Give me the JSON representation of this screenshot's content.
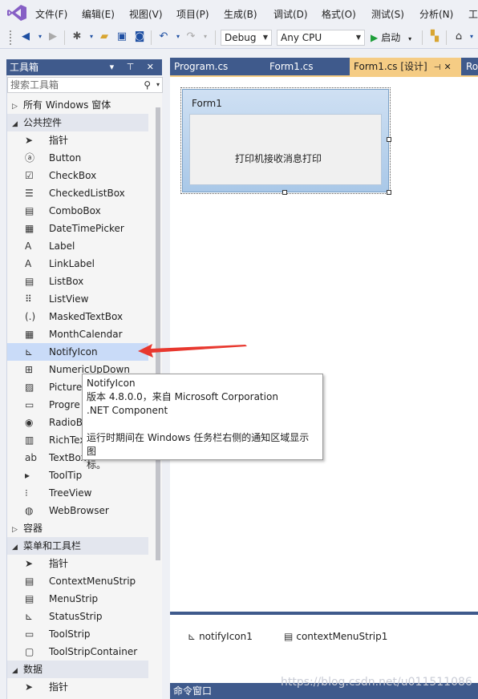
{
  "menubar": {
    "items": [
      "文件(F)",
      "编辑(E)",
      "视图(V)",
      "项目(P)",
      "生成(B)",
      "调试(D)",
      "格式(O)",
      "测试(S)",
      "分析(N)",
      "工"
    ]
  },
  "toolbar": {
    "config": "Debug",
    "platform": "Any CPU",
    "start_label": "启动"
  },
  "toolbox": {
    "title": "工具箱",
    "header_controls": "▾ ⊤ ✕",
    "search_placeholder": "搜索工具箱",
    "rows": [
      {
        "kind": "cat",
        "open": false,
        "label": "所有 Windows 窗体"
      },
      {
        "kind": "cat",
        "open": true,
        "label": "公共控件"
      },
      {
        "kind": "item",
        "icon": "pointer-icon",
        "label": "指针"
      },
      {
        "kind": "item",
        "icon": "button-icon",
        "label": "Button"
      },
      {
        "kind": "item",
        "icon": "checkbox-icon",
        "label": "CheckBox"
      },
      {
        "kind": "item",
        "icon": "checkedlistbox-icon",
        "label": "CheckedListBox"
      },
      {
        "kind": "item",
        "icon": "combobox-icon",
        "label": "ComboBox"
      },
      {
        "kind": "item",
        "icon": "datetimepicker-icon",
        "label": "DateTimePicker"
      },
      {
        "kind": "item",
        "icon": "label-icon",
        "label": "Label"
      },
      {
        "kind": "item",
        "icon": "linklabel-icon",
        "label": "LinkLabel"
      },
      {
        "kind": "item",
        "icon": "listbox-icon",
        "label": "ListBox"
      },
      {
        "kind": "item",
        "icon": "listview-icon",
        "label": "ListView"
      },
      {
        "kind": "item",
        "icon": "maskedtextbox-icon",
        "label": "MaskedTextBox"
      },
      {
        "kind": "item",
        "icon": "monthcalendar-icon",
        "label": "MonthCalendar"
      },
      {
        "kind": "item",
        "icon": "notifyicon-icon",
        "label": "NotifyIcon",
        "selected": true
      },
      {
        "kind": "item",
        "icon": "numericupdown-icon",
        "label": "NumericUpDown"
      },
      {
        "kind": "item",
        "icon": "picturebox-icon",
        "label": "Picture"
      },
      {
        "kind": "item",
        "icon": "progressbar-icon",
        "label": "Progre"
      },
      {
        "kind": "item",
        "icon": "radiobutton-icon",
        "label": "RadioB"
      },
      {
        "kind": "item",
        "icon": "richtextbox-icon",
        "label": "RichTex"
      },
      {
        "kind": "item",
        "icon": "textbox-icon",
        "label": "TextBox"
      },
      {
        "kind": "item",
        "icon": "tooltip-icon",
        "label": "ToolTip"
      },
      {
        "kind": "item",
        "icon": "treeview-icon",
        "label": "TreeView"
      },
      {
        "kind": "item",
        "icon": "webbrowser-icon",
        "label": "WebBrowser"
      },
      {
        "kind": "cat",
        "open": false,
        "label": "容器"
      },
      {
        "kind": "cat",
        "open": true,
        "label": "菜单和工具栏"
      },
      {
        "kind": "item",
        "icon": "pointer-icon",
        "label": "指针"
      },
      {
        "kind": "item",
        "icon": "contextmenustrip-icon",
        "label": "ContextMenuStrip"
      },
      {
        "kind": "item",
        "icon": "menustrip-icon",
        "label": "MenuStrip"
      },
      {
        "kind": "item",
        "icon": "statusstrip-icon",
        "label": "StatusStrip"
      },
      {
        "kind": "item",
        "icon": "toolstrip-icon",
        "label": "ToolStrip"
      },
      {
        "kind": "item",
        "icon": "toolstripcontainer-icon",
        "label": "ToolStripContainer"
      },
      {
        "kind": "cat",
        "open": true,
        "label": "数据"
      },
      {
        "kind": "item",
        "icon": "pointer-icon",
        "label": "指针"
      }
    ]
  },
  "tabs": [
    {
      "label": "Program.cs",
      "active": false
    },
    {
      "label": "Form1.cs",
      "active": false
    },
    {
      "label": "Form1.cs [设计]",
      "active": true
    },
    {
      "label": "Ro",
      "active": false
    }
  ],
  "designer": {
    "form_title": "Form1",
    "form_label": "打印机接收消息打印"
  },
  "tray": {
    "items": [
      "notifyIcon1",
      "contextMenuStrip1"
    ]
  },
  "tooltip": {
    "title": "NotifyIcon",
    "version": "版本 4.8.0.0，来自 Microsoft Corporation",
    "kind": ".NET Component",
    "desc_line1": "运行时期间在 Windows 任务栏右侧的通知区域显示图",
    "desc_line2": "标。"
  },
  "command_window": "命令窗口",
  "watermark": "https://blog.csdn.net/u011511086",
  "colors": {
    "accent": "#3f5a8c",
    "active_tab": "#f5cc84",
    "selection": "#c9dbf8",
    "arrow": "#e8382f",
    "vs_purple": "#865fc5"
  }
}
